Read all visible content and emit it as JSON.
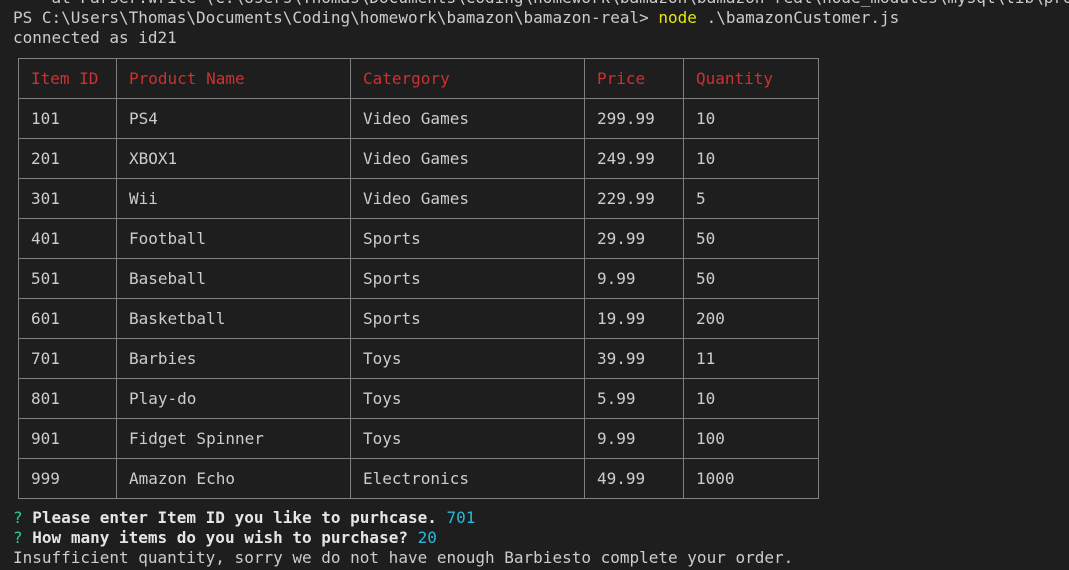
{
  "terminal": {
    "cut_line": "    at Parser.write (C:\\Users\\Thomas\\Documents\\Coding\\homework\\bamazon\\bamazon-real\\node_modules\\mysql\\lib\\protocol\\Pa",
    "prompt_path": "PS C:\\Users\\Thomas\\Documents\\Coding\\homework\\bamazon\\bamazon-real> ",
    "command": "node",
    "command_arg": " .\\bamazonCustomer.js",
    "connected": "connected as id21"
  },
  "table": {
    "headers": [
      "Item ID",
      "Product Name",
      "Catergory",
      "Price",
      "Quantity"
    ],
    "rows": [
      [
        "101",
        "PS4",
        "Video Games",
        "299.99",
        "10"
      ],
      [
        "201",
        "XBOX1",
        "Video Games",
        "249.99",
        "10"
      ],
      [
        "301",
        "Wii",
        "Video Games",
        "229.99",
        "5"
      ],
      [
        "401",
        "Football",
        "Sports",
        "29.99",
        "50"
      ],
      [
        "501",
        "Baseball",
        "Sports",
        "9.99",
        "50"
      ],
      [
        "601",
        "Basketball",
        "Sports",
        "19.99",
        "200"
      ],
      [
        "701",
        "Barbies",
        "Toys",
        "39.99",
        "11"
      ],
      [
        "801",
        "Play-do",
        "Toys",
        "5.99",
        "10"
      ],
      [
        "901",
        "Fidget Spinner",
        "Toys",
        "9.99",
        "100"
      ],
      [
        "999",
        "Amazon Echo",
        "Electronics",
        "49.99",
        "1000"
      ]
    ]
  },
  "prompts": {
    "mark": "?",
    "q1": "Please enter Item ID you like to purhcase.",
    "a1": "701",
    "q2": "How many items do you wish to purchase?",
    "a2": "20"
  },
  "message": "Insufficient quantity, sorry we do not have enough Barbiesto complete your order.",
  "colors": {
    "background": "#1e1e1e",
    "text": "#cccccc",
    "header": "#cd3131",
    "command": "#e5e510",
    "question_mark": "#23d18b",
    "answer": "#29b8db",
    "border": "#808080"
  }
}
